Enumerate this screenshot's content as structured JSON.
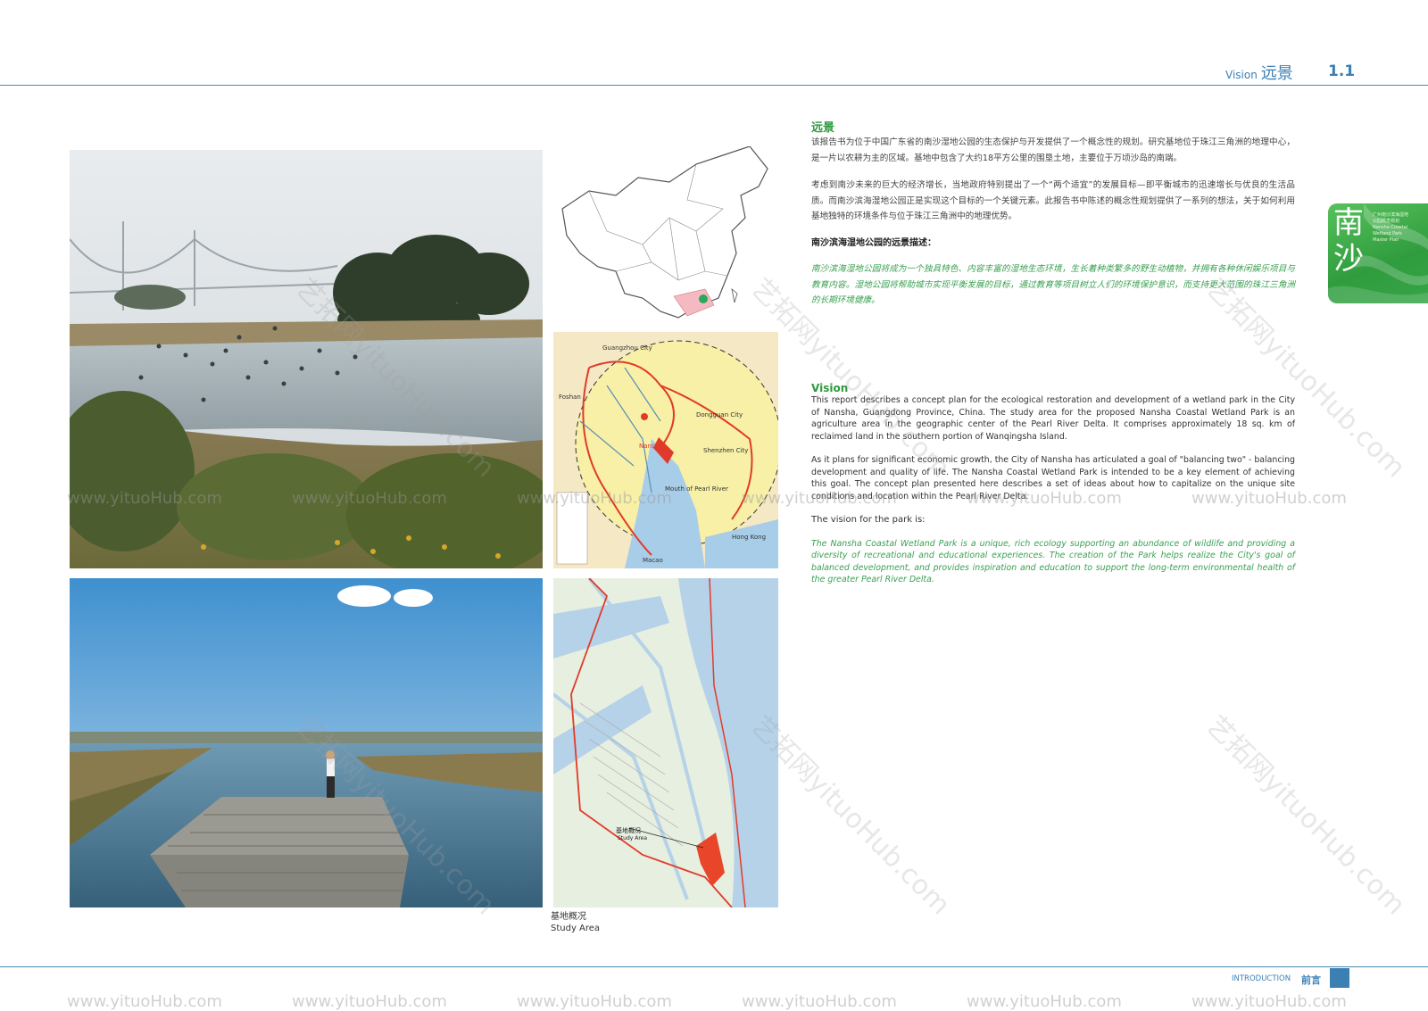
{
  "header": {
    "title_en": "Vision",
    "title_cn": "远景",
    "page_number": "1.1"
  },
  "side_tab": {
    "label": "南沙",
    "subtitle": "广州南沙滨海湿地公园概念规划 Nansha Coastal Wetland Park Master Plan"
  },
  "cn_section": {
    "heading": "远景",
    "para1": "该报告书为位于中国广东省的南沙湿地公园的生态保护与开发提供了一个概念性的规划。研究基地位于珠江三角洲的地理中心，是一片以农耕为主的区域。基地中包含了大约18平方公里的围垦土地，主要位于万顷沙岛的南端。",
    "para2": "考虑到南沙未来的巨大的经济增长，当地政府特别提出了一个“两个适宜”的发展目标—即平衡城市的迅速增长与优良的生活品质。而南沙滨海湿地公园正是实现这个目标的一个关键元素。此报告书中陈述的概念性规划提供了一系列的想法，关于如何利用基地独特的环境条件与位于珠江三角洲中的地理优势。",
    "vision_heading": "南沙滨海湿地公园的远景描述：",
    "vision_text": "南沙滨海湿地公园将成为一个独具特色、内容丰富的湿地生态环境，生长着种类繁多的野生动植物，并拥有各种休闲娱乐项目与教育内容。湿地公园将帮助城市实现平衡发展的目标，通过教育等项目树立人们的环境保护意识，而支持更大范围的珠江三角洲的长期环境健康。"
  },
  "en_section": {
    "heading": "Vision",
    "para1": "This report describes a concept plan for the ecological restoration and development of a wetland park in the City of Nansha, Guangdong Province, China. The study area for the proposed Nansha Coastal Wetland Park is an agriculture area in the geographic center of the Pearl River Delta. It comprises approximately 18 sq. km of reclaimed land in the southern portion of Wanqingsha Island.",
    "para2": "As it plans for significant economic growth, the City of Nansha has articulated a goal of \"balancing two\" - balancing development and quality of life. The Nansha Coastal Wetland Park is intended to be a key element of achieving this goal. The concept plan presented here describes a set of ideas about how to capitalize on the unique site conditions and location within the Pearl River Delta.",
    "vision_label": "The vision for the park is:",
    "vision_text": "The Nansha Coastal Wetland Park is a unique, rich ecology supporting an abundance of wildlife and providing a diversity of recreational and educational experiences. The creation of the Park helps realize the City's goal of balanced development, and provides inspiration and education to support the long-term environmental health of the greater Pearl River Delta."
  },
  "maps": {
    "delta_labels": [
      "Guangzhou City",
      "Foshan",
      "Dongguan City",
      "Shenzhen City",
      "Mouth of Pearl River",
      "Hong Kong",
      "Macao",
      "Nansha"
    ],
    "study_area_label_cn": "基地概况",
    "study_area_label_en": "Study Area"
  },
  "caption": {
    "cn": "基地概况",
    "en": "Study Area"
  },
  "footer": {
    "label_en": "INTRODUCTION",
    "label_cn": "前言"
  },
  "watermark": {
    "text": "www.yituoHub.com",
    "diag_text": "艺拓网yituoHub.com"
  },
  "colors": {
    "accent_green": "#2d9a3d",
    "accent_blue": "#3b7fb3",
    "route_red": "#e03b2a"
  }
}
